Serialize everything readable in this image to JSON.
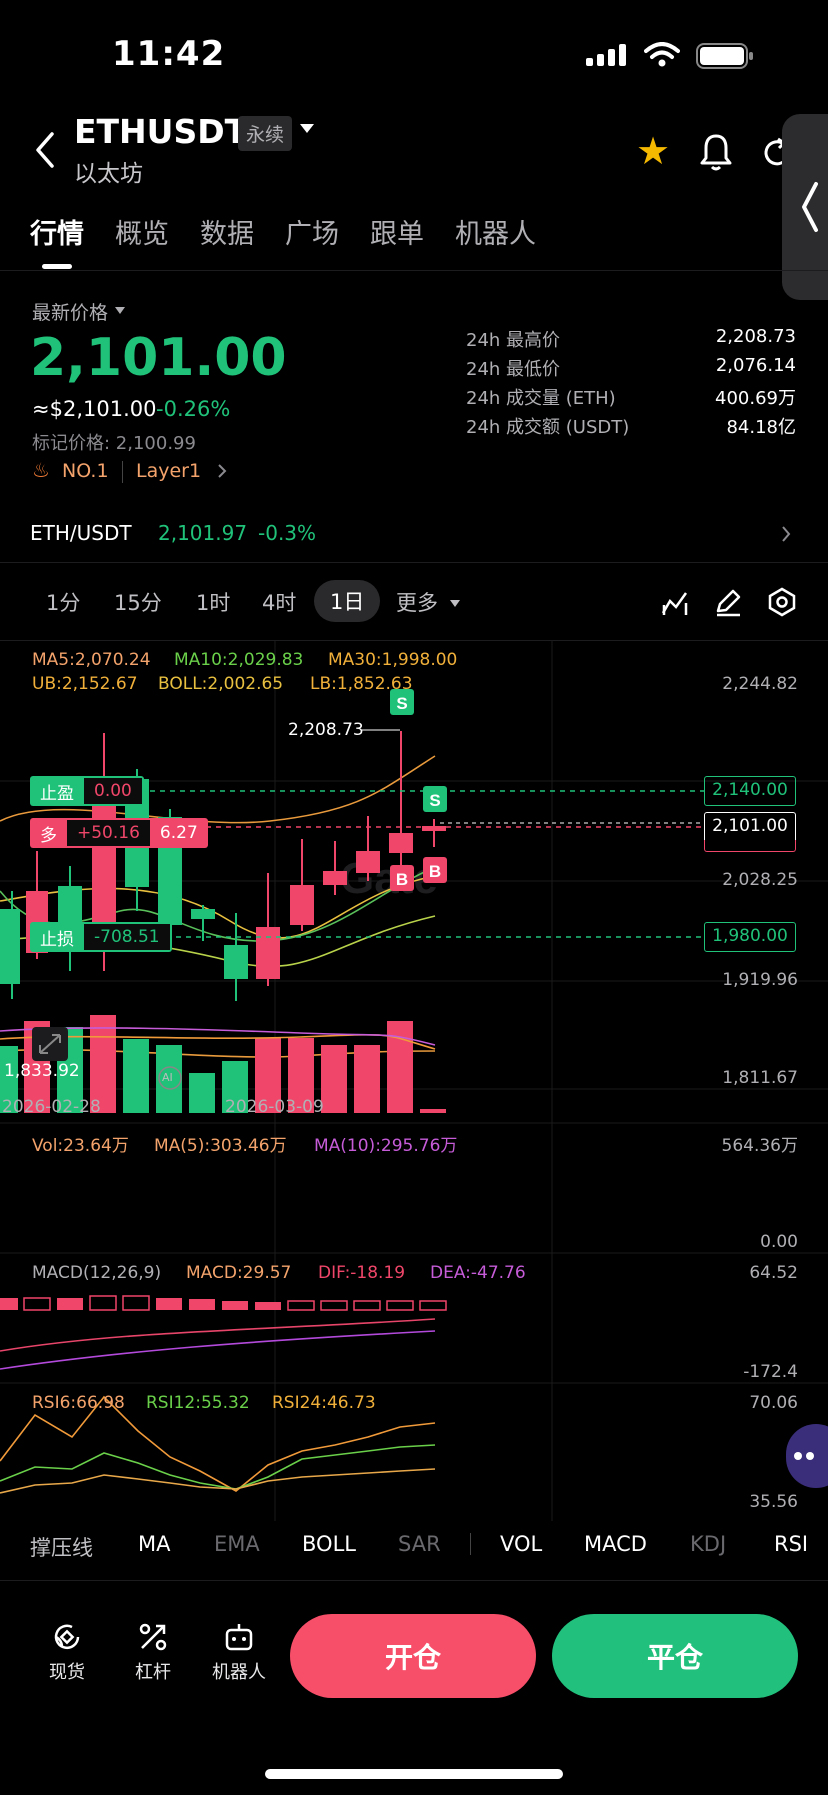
{
  "status": {
    "time": "11:42"
  },
  "header": {
    "pair": "ETHUSDT",
    "badge": "永续",
    "subtitle": "以太坊"
  },
  "tabs": [
    "行情",
    "概览",
    "数据",
    "广场",
    "跟单",
    "机器人"
  ],
  "price": {
    "latest_label": "最新价格",
    "last": "2,101.00",
    "usd": "≈$2,101.00",
    "change": "-0.26%",
    "mark": "标记价格: 2,100.99",
    "rank": "NO.1",
    "tag": "Layer1"
  },
  "stats": [
    {
      "label": "24h 最高价",
      "value": "2,208.73"
    },
    {
      "label": "24h 最低价",
      "value": "2,076.14"
    },
    {
      "label": "24h 成交量 (ETH)",
      "value": "400.69万"
    },
    {
      "label": "24h 成交额 (USDT)",
      "value": "84.18亿"
    }
  ],
  "spot": {
    "pair": "ETH/USDT",
    "price": "2,101.97",
    "change": "-0.3%"
  },
  "intervals": [
    "1分",
    "15分",
    "1时",
    "4时",
    "1日",
    "更多"
  ],
  "active_interval": "1日",
  "main_indicators": {
    "ma5": "MA5:2,070.24",
    "ma10": "MA10:2,029.83",
    "ma30": "MA30:1,998.00",
    "ub": "UB:2,152.67",
    "boll": "BOLL:2,002.65",
    "lb": "LB:1,852.63"
  },
  "price_axis": [
    "2,244.82",
    "2,028.25",
    "1,919.96",
    "1,811.67"
  ],
  "high_marker": "2,208.73",
  "low_marker": "1,833.92",
  "dates": [
    "2026-02-28",
    "2026-03-09"
  ],
  "orders": {
    "tp_label": "止盈",
    "tp_value": "0.00",
    "tp_price": "2,140.00",
    "long_label": "多",
    "long_pnl": "+50.16",
    "long_qty": "6.27",
    "current_price": "2,101.00",
    "sl_label": "止损",
    "sl_value": "-708.51",
    "sl_price": "1,980.00"
  },
  "trade_markers": {
    "sell": "S",
    "buy": "B"
  },
  "ai_badge": "AI",
  "vol": {
    "label": "Vol:23.64万",
    "ma5": "MA(5):303.46万",
    "ma10": "MA(10):295.76万",
    "max": "564.36万",
    "min": "0.00"
  },
  "macd": {
    "label": "MACD(12,26,9)",
    "macd": "MACD:29.57",
    "dif": "DIF:-18.19",
    "dea": "DEA:-47.76",
    "max": "64.52",
    "min": "-172.4"
  },
  "rsi": {
    "rsi6": "RSI6:66.98",
    "rsi12": "RSI12:55.32",
    "rsi24": "RSI24:46.73",
    "max": "70.06",
    "min": "35.56"
  },
  "indicator_tabs": [
    "撑压线",
    "MA",
    "EMA",
    "BOLL",
    "SAR",
    "VOL",
    "MACD",
    "KDJ",
    "RSI"
  ],
  "bottom_bar": {
    "spot": "现货",
    "leverage": "杠杆",
    "bot": "机器人",
    "open": "开仓",
    "close": "平仓"
  },
  "colors": {
    "up": "#f0466a",
    "down": "#20c27a",
    "accent": "#f5b800"
  }
}
